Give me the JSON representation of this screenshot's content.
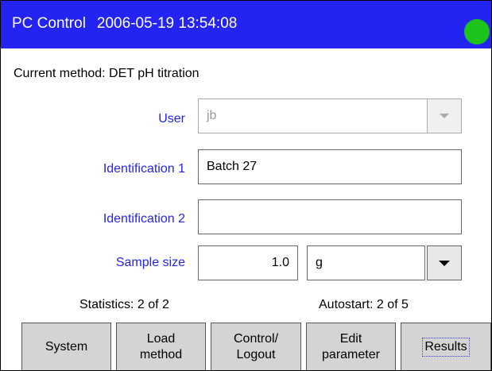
{
  "header": {
    "app_title": "PC Control",
    "datetime": "2006-05-19 13:54:08",
    "status_color": "#1cc31c"
  },
  "current_method": "Current method: DET pH titration",
  "form": {
    "user": {
      "label": "User",
      "value": "jb",
      "enabled": false
    },
    "identification1": {
      "label": "Identification 1",
      "value": "Batch 27"
    },
    "identification2": {
      "label": "Identification 2",
      "value": ""
    },
    "sample_size": {
      "label": "Sample size",
      "value": "1.0",
      "unit": "g"
    }
  },
  "stats": {
    "statistics": "Statistics: 2 of 2",
    "autostart": "Autostart: 2 of 5"
  },
  "buttons": {
    "system": "System",
    "load_method": "Load\nmethod",
    "control_logout": "Control/\nLogout",
    "edit_parameter": "Edit\nparameter",
    "results": "Results"
  },
  "colors": {
    "title_bar": "#2323f2",
    "label_text": "#2323f2",
    "button_face": "#d4d4d4"
  }
}
